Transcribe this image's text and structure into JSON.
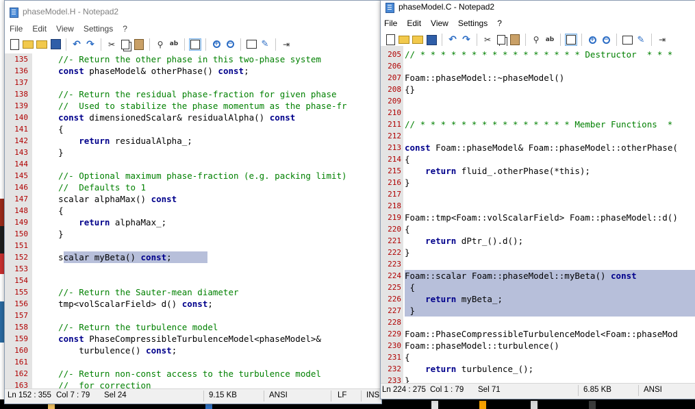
{
  "left_window": {
    "title": "phaseModel.H - Notepad2",
    "menu": [
      "File",
      "Edit",
      "View",
      "Settings",
      "?"
    ],
    "status": {
      "position": "Ln 152 : 355",
      "column": "Col 7 : 79",
      "selection": "Sel 24",
      "size": "9.15 KB",
      "encoding": "ANSI",
      "eol": "LF",
      "mode": "INS"
    },
    "lines": [
      {
        "n": "135",
        "t": "    //- Return the other phase in this two-phase system"
      },
      {
        "n": "136",
        "t": "    const phaseModel& otherPhase() const;"
      },
      {
        "n": "137",
        "t": ""
      },
      {
        "n": "138",
        "t": "    //- Return the residual phase-fraction for given phase"
      },
      {
        "n": "139",
        "t": "    //  Used to stabilize the phase momentum as the phase-fr"
      },
      {
        "n": "140",
        "t": "    const dimensionedScalar& residualAlpha() const"
      },
      {
        "n": "141",
        "t": "    {"
      },
      {
        "n": "142",
        "t": "        return residualAlpha_;"
      },
      {
        "n": "143",
        "t": "    }"
      },
      {
        "n": "144",
        "t": ""
      },
      {
        "n": "145",
        "t": "    //- Optional maximum phase-fraction (e.g. packing limit)"
      },
      {
        "n": "146",
        "t": "    //  Defaults to 1"
      },
      {
        "n": "147",
        "t": "    scalar alphaMax() const"
      },
      {
        "n": "148",
        "t": "    {"
      },
      {
        "n": "149",
        "t": "        return alphaMax_;"
      },
      {
        "n": "150",
        "t": "    }"
      },
      {
        "n": "151",
        "t": ""
      },
      {
        "n": "152",
        "t": "    scalar myBeta() const;"
      },
      {
        "n": "153",
        "t": ""
      },
      {
        "n": "154",
        "t": ""
      },
      {
        "n": "155",
        "t": "    //- Return the Sauter-mean diameter"
      },
      {
        "n": "156",
        "t": "    tmp<volScalarField> d() const;"
      },
      {
        "n": "157",
        "t": ""
      },
      {
        "n": "158",
        "t": "    //- Return the turbulence model"
      },
      {
        "n": "159",
        "t": "    const PhaseCompressibleTurbulenceModel<phaseModel>&"
      },
      {
        "n": "160",
        "t": "        turbulence() const;"
      },
      {
        "n": "161",
        "t": ""
      },
      {
        "n": "162",
        "t": "    //- Return non-const access to the turbulence model"
      },
      {
        "n": "163",
        "t": "    //  for correction"
      }
    ]
  },
  "right_window": {
    "title": "phaseModel.C - Notepad2",
    "menu": [
      "File",
      "Edit",
      "View",
      "Settings",
      "?"
    ],
    "status": {
      "position": "Ln 224 : 275",
      "column": "Col 1 : 79",
      "selection": "Sel 71",
      "size": "6.85 KB",
      "encoding": "ANSI"
    },
    "lines": [
      {
        "n": "205",
        "t": "// * * * * * * * * * * * * * * * * Destructor  * * *"
      },
      {
        "n": "206",
        "t": ""
      },
      {
        "n": "207",
        "t": "Foam::phaseModel::~phaseModel()"
      },
      {
        "n": "208",
        "t": "{}"
      },
      {
        "n": "209",
        "t": ""
      },
      {
        "n": "210",
        "t": ""
      },
      {
        "n": "211",
        "t": "// * * * * * * * * * * * * * * * Member Functions  *"
      },
      {
        "n": "212",
        "t": ""
      },
      {
        "n": "213",
        "t": "const Foam::phaseModel& Foam::phaseModel::otherPhase("
      },
      {
        "n": "214",
        "t": "{"
      },
      {
        "n": "215",
        "t": "    return fluid_.otherPhase(*this);"
      },
      {
        "n": "216",
        "t": "}"
      },
      {
        "n": "217",
        "t": ""
      },
      {
        "n": "218",
        "t": ""
      },
      {
        "n": "219",
        "t": "Foam::tmp<Foam::volScalarField> Foam::phaseModel::d()"
      },
      {
        "n": "220",
        "t": "{"
      },
      {
        "n": "221",
        "t": "    return dPtr_().d();"
      },
      {
        "n": "222",
        "t": "}"
      },
      {
        "n": "223",
        "t": ""
      },
      {
        "n": "224",
        "t": "Foam::scalar Foam::phaseModel::myBeta() const"
      },
      {
        "n": "225",
        "t": " {"
      },
      {
        "n": "226",
        "t": "    return myBeta_;"
      },
      {
        "n": "227",
        "t": " }"
      },
      {
        "n": "228",
        "t": ""
      },
      {
        "n": "229",
        "t": "Foam::PhaseCompressibleTurbulenceModel<Foam::phaseMod"
      },
      {
        "n": "230",
        "t": "Foam::phaseModel::turbulence()"
      },
      {
        "n": "231",
        "t": "{"
      },
      {
        "n": "232",
        "t": "    return turbulence_();"
      },
      {
        "n": "233",
        "t": "}"
      }
    ]
  }
}
